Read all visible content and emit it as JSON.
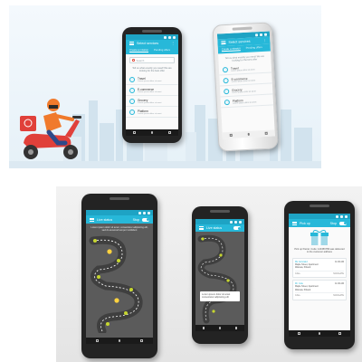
{
  "colors": {
    "accent": "#27b8d9",
    "accent_dark": "#1ea3c4",
    "scooter": "#e0403a",
    "rider_shirt": "#f07a2c",
    "road": "#3f3f3f",
    "flag": "#c6d62f"
  },
  "phone_search": {
    "app_title": "Select services",
    "tabs": [
      "Create a mission",
      "Pending offers"
    ],
    "search_placeholder": "Search",
    "prompt": "Tell us what exactly you need! We are looking for the best offer",
    "categories": [
      {
        "icon": "bike-icon",
        "label": "Travel",
        "sub": "Lorem ipsum dolor sit amet"
      },
      {
        "icon": "cart-icon",
        "label": "E-commerce",
        "sub": "Lorem ipsum dolor sit amet"
      },
      {
        "icon": "basket-icon",
        "label": "Grocery",
        "sub": "Lorem ipsum dolor sit amet"
      },
      {
        "icon": "dish-icon",
        "label": "Platform",
        "sub": "Lorem ipsum dolor sit amet"
      }
    ]
  },
  "phone_track": {
    "app_title": "Live status",
    "toggle_label": "Stop",
    "tip": "Lorem ipsum dolor sit amet, consectetur adipiscing elit, sed do eiusmod tempor incididunt",
    "tipbox": "Lorem ipsum dolor sit amet, consectetur adipiscing elit"
  },
  "phone_track_small": {
    "app_title": "Live status",
    "tipbox": "Lorem ipsum dolor sit amet consectetur adipiscing elit"
  },
  "phone_delivery": {
    "app_title": "Pick up",
    "toggle_label": "Stop",
    "message": "Pick up Parcel. Code: 123456789 was delivered to the customer address",
    "cards": [
      {
        "title": "Ms Gonzalez",
        "time": "11:30 AM",
        "address": "Maple Street, Apartment",
        "city": "Warsaw, Poland",
        "status_left": "CALL",
        "status_right": "NAVIGATE"
      },
      {
        "title": "Mr. Cole",
        "time": "11:30 AM",
        "address": "Maple Street, Apartment",
        "city": "Warsaw, Poland",
        "status_left": "CALL",
        "status_right": "NAVIGATE"
      }
    ]
  }
}
